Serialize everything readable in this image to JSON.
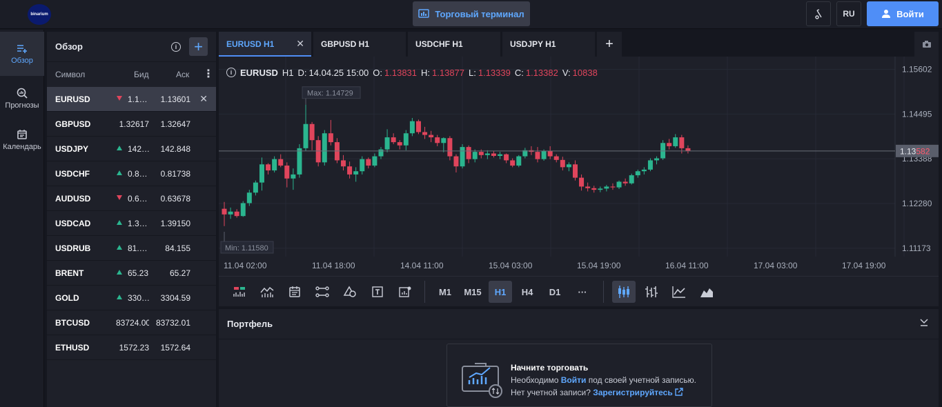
{
  "header": {
    "logo_text": "binarium",
    "terminal_label": "Торговый терминал",
    "lang": "RU",
    "login_label": "Войти"
  },
  "rail": [
    {
      "label": "Обзор",
      "icon": "list-add-icon",
      "active": true
    },
    {
      "label": "Прогнозы",
      "icon": "magnifier-chart-icon",
      "active": false
    },
    {
      "label": "Календарь",
      "icon": "calendar-icon",
      "active": false
    }
  ],
  "overview": {
    "title": "Обзор",
    "columns": {
      "symbol": "Символ",
      "bid": "Бид",
      "ask": "Аск"
    },
    "rows": [
      {
        "symbol": "EURUSD",
        "bid": "1.1…",
        "ask": "1.13601",
        "dir": "down",
        "selected": true
      },
      {
        "symbol": "GBPUSD",
        "bid": "1.32617",
        "ask": "1.32647",
        "dir": "",
        "selected": false
      },
      {
        "symbol": "USDJPY",
        "bid": "142…",
        "ask": "142.848",
        "dir": "up",
        "selected": false
      },
      {
        "symbol": "USDCHF",
        "bid": "0.8…",
        "ask": "0.81738",
        "dir": "up",
        "selected": false
      },
      {
        "symbol": "AUDUSD",
        "bid": "0.6…",
        "ask": "0.63678",
        "dir": "down",
        "selected": false
      },
      {
        "symbol": "USDCAD",
        "bid": "1.3…",
        "ask": "1.39150",
        "dir": "up",
        "selected": false
      },
      {
        "symbol": "USDRUB",
        "bid": "81.…",
        "ask": "84.155",
        "dir": "up",
        "selected": false
      },
      {
        "symbol": "BRENT",
        "bid": "65.23",
        "ask": "65.27",
        "dir": "up",
        "selected": false
      },
      {
        "symbol": "GOLD",
        "bid": "330…",
        "ask": "3304.59",
        "dir": "up",
        "selected": false
      },
      {
        "symbol": "BTCUSD",
        "bid": "83724.00",
        "ask": "83732.01",
        "dir": "",
        "selected": false
      },
      {
        "symbol": "ETHUSD",
        "bid": "1572.23",
        "ask": "1572.64",
        "dir": "",
        "selected": false
      }
    ]
  },
  "tabs": [
    {
      "label": "EURUSD H1",
      "active": true,
      "closable": true
    },
    {
      "label": "GBPUSD H1",
      "active": false,
      "closable": false
    },
    {
      "label": "USDCHF H1",
      "active": false,
      "closable": false
    },
    {
      "label": "USDJPY H1",
      "active": false,
      "closable": false
    }
  ],
  "legend": {
    "symbol": "EURUSD",
    "tf": "H1",
    "d_label": "D:",
    "date": "14.04.25 15:00",
    "o_label": "O:",
    "o": "1.13831",
    "h_label": "H:",
    "h": "1.13877",
    "l_label": "L:",
    "l": "1.13339",
    "c_label": "C:",
    "c": "1.13382",
    "v_label": "V:",
    "v": "10838"
  },
  "chart_data": {
    "type": "candlestick",
    "max_label": "Max: 1.14729",
    "min_label": "Min: 1.11580",
    "max": 1.14729,
    "min": 1.1158,
    "ylim": [
      1.1105,
      1.1575
    ],
    "y_ticks": [
      "1.15602",
      "1.14495",
      "1.13388",
      "1.12280",
      "1.11173"
    ],
    "y_tick_values": [
      1.15602,
      1.14495,
      1.13388,
      1.1228,
      1.11173
    ],
    "current_price_main": "1.13",
    "current_price_tail": "582",
    "current_price": 1.13582,
    "x_ticks": [
      "11.04 02:00",
      "11.04 18:00",
      "14.04 11:00",
      "15.04 03:00",
      "15.04 19:00",
      "16.04 11:00",
      "17.04 03:00",
      "17.04 19:00"
    ],
    "candles": [
      [
        1.1215,
        1.1232,
        1.1172,
        1.1201
      ],
      [
        1.1201,
        1.1218,
        1.119,
        1.1208
      ],
      [
        1.1208,
        1.1214,
        1.1193,
        1.1197
      ],
      [
        1.1197,
        1.1234,
        1.1195,
        1.1229
      ],
      [
        1.1229,
        1.1262,
        1.1222,
        1.1255
      ],
      [
        1.1255,
        1.1285,
        1.1248,
        1.128
      ],
      [
        1.128,
        1.1342,
        1.126,
        1.1325
      ],
      [
        1.1325,
        1.1328,
        1.13,
        1.131
      ],
      [
        1.131,
        1.1345,
        1.1305,
        1.1338
      ],
      [
        1.1338,
        1.135,
        1.1318,
        1.1322
      ],
      [
        1.1322,
        1.133,
        1.1268,
        1.129
      ],
      [
        1.129,
        1.1315,
        1.1262,
        1.13
      ],
      [
        1.13,
        1.1375,
        1.1292,
        1.1365
      ],
      [
        1.1365,
        1.1473,
        1.1358,
        1.1425
      ],
      [
        1.1425,
        1.143,
        1.136,
        1.1385
      ],
      [
        1.1385,
        1.1395,
        1.132,
        1.133
      ],
      [
        1.133,
        1.141,
        1.1322,
        1.1402
      ],
      [
        1.1402,
        1.1435,
        1.1372,
        1.138
      ],
      [
        1.138,
        1.139,
        1.1328,
        1.1335
      ],
      [
        1.1335,
        1.1348,
        1.131,
        1.132
      ],
      [
        1.132,
        1.1332,
        1.129,
        1.13
      ],
      [
        1.13,
        1.1318,
        1.1282,
        1.1308
      ],
      [
        1.1308,
        1.1345,
        1.13,
        1.1338
      ],
      [
        1.1338,
        1.1342,
        1.1315,
        1.1322
      ],
      [
        1.1322,
        1.1352,
        1.1318,
        1.1345
      ],
      [
        1.1345,
        1.1368,
        1.1338,
        1.1362
      ],
      [
        1.1362,
        1.1412,
        1.1355,
        1.1392
      ],
      [
        1.1392,
        1.1402,
        1.1375,
        1.138
      ],
      [
        1.138,
        1.1385,
        1.1362,
        1.1372
      ],
      [
        1.1372,
        1.141,
        1.136,
        1.1402
      ],
      [
        1.1402,
        1.144,
        1.1395,
        1.1432
      ],
      [
        1.1432,
        1.1436,
        1.14,
        1.1405
      ],
      [
        1.1405,
        1.1418,
        1.1388,
        1.1398
      ],
      [
        1.1398,
        1.1408,
        1.138,
        1.1392
      ],
      [
        1.1392,
        1.1398,
        1.137,
        1.1378
      ],
      [
        1.1378,
        1.1392,
        1.1355,
        1.139
      ],
      [
        1.139,
        1.1395,
        1.1335,
        1.1345
      ],
      [
        1.1345,
        1.135,
        1.1305,
        1.132
      ],
      [
        1.132,
        1.1375,
        1.1315,
        1.1368
      ],
      [
        1.1368,
        1.1372,
        1.1328,
        1.1338
      ],
      [
        1.1338,
        1.1362,
        1.133,
        1.1356
      ],
      [
        1.1356,
        1.1362,
        1.134,
        1.1348
      ],
      [
        1.1348,
        1.136,
        1.1338,
        1.1352
      ],
      [
        1.1352,
        1.1358,
        1.1342,
        1.1346
      ],
      [
        1.1346,
        1.1356,
        1.1338,
        1.135
      ],
      [
        1.135,
        1.1352,
        1.1328,
        1.1335
      ],
      [
        1.1335,
        1.134,
        1.1318,
        1.1322
      ],
      [
        1.1322,
        1.1348,
        1.1318,
        1.1345
      ],
      [
        1.1345,
        1.1366,
        1.134,
        1.136
      ],
      [
        1.136,
        1.137,
        1.1348,
        1.1356
      ],
      [
        1.1356,
        1.1368,
        1.133,
        1.1338
      ],
      [
        1.1338,
        1.1362,
        1.1334,
        1.1358
      ],
      [
        1.1358,
        1.137,
        1.1338,
        1.1345
      ],
      [
        1.1345,
        1.135,
        1.133,
        1.1336
      ],
      [
        1.1336,
        1.1344,
        1.131,
        1.1318
      ],
      [
        1.1318,
        1.133,
        1.1308,
        1.1325
      ],
      [
        1.1325,
        1.1335,
        1.1285,
        1.1292
      ],
      [
        1.1292,
        1.13,
        1.126,
        1.127
      ],
      [
        1.127,
        1.128,
        1.1258,
        1.1266
      ],
      [
        1.1266,
        1.1272,
        1.1255,
        1.1262
      ],
      [
        1.1262,
        1.127,
        1.1256,
        1.1265
      ],
      [
        1.1265,
        1.1274,
        1.1258,
        1.127
      ],
      [
        1.127,
        1.1278,
        1.1262,
        1.1268
      ],
      [
        1.1268,
        1.1285,
        1.1264,
        1.1282
      ],
      [
        1.1282,
        1.129,
        1.1272,
        1.1278
      ],
      [
        1.1278,
        1.1302,
        1.1275,
        1.1298
      ],
      [
        1.1298,
        1.1312,
        1.1292,
        1.1308
      ],
      [
        1.1308,
        1.1318,
        1.13,
        1.1312
      ],
      [
        1.1312,
        1.134,
        1.1308,
        1.1335
      ],
      [
        1.1335,
        1.1345,
        1.1325,
        1.134
      ],
      [
        1.134,
        1.1385,
        1.1336,
        1.1378
      ],
      [
        1.1378,
        1.1388,
        1.1362,
        1.137
      ],
      [
        1.137,
        1.14,
        1.1366,
        1.1392
      ],
      [
        1.1392,
        1.1398,
        1.1352,
        1.1365
      ],
      [
        1.1365,
        1.1372,
        1.1352,
        1.1358
      ]
    ]
  },
  "toolbar": {
    "timeframes": [
      "M1",
      "M15",
      "H1",
      "H4",
      "D1"
    ],
    "active_tf": "H1",
    "more": "···"
  },
  "portfolio": {
    "title": "Портфель",
    "card_title": "Начните торговать",
    "line2_a": "Необходимо ",
    "line2_link": "Войти",
    "line2_b": " под своей учетной записью.",
    "line3_a": "Нет учетной записи? ",
    "line3_link": "Зарегистрируйтесь"
  },
  "colors": {
    "up": "#2bb58f",
    "down": "#e0455c",
    "accent": "#4f8ef7"
  }
}
